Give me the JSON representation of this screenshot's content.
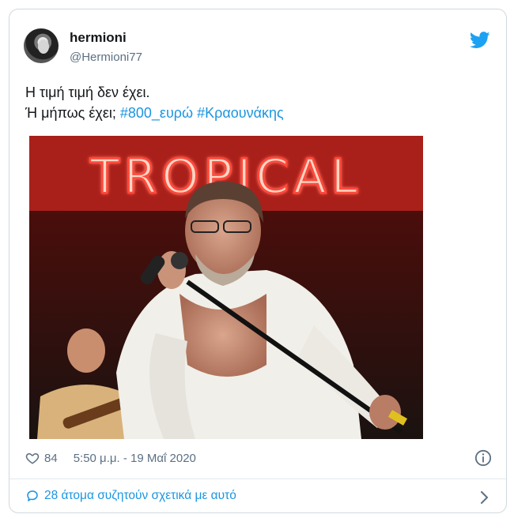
{
  "author": {
    "display_name": "hermioni",
    "handle": "@Hermioni77"
  },
  "tweet": {
    "line1": "Η τιμή τιμή δεν έχει.",
    "line2_prefix": "Ή μήπως έχει; ",
    "hashtag1": "#800_ευρώ",
    "hashtag2": "#Κραουνάκης"
  },
  "photo": {
    "sign_text": "TROPICAL"
  },
  "meta": {
    "likes": "84",
    "timestamp": "5:50 μ.μ. - 19 Μαΐ 2020"
  },
  "footer": {
    "discussion": "28 άτομα συζητούν σχετικά με αυτό"
  },
  "colors": {
    "link": "#1b95e0",
    "twitter_blue": "#1da1f2",
    "muted": "#5b7083"
  },
  "icons": [
    "twitter-bird-icon",
    "heart-icon",
    "info-icon",
    "reply-bubble-icon",
    "chevron-right-icon"
  ]
}
